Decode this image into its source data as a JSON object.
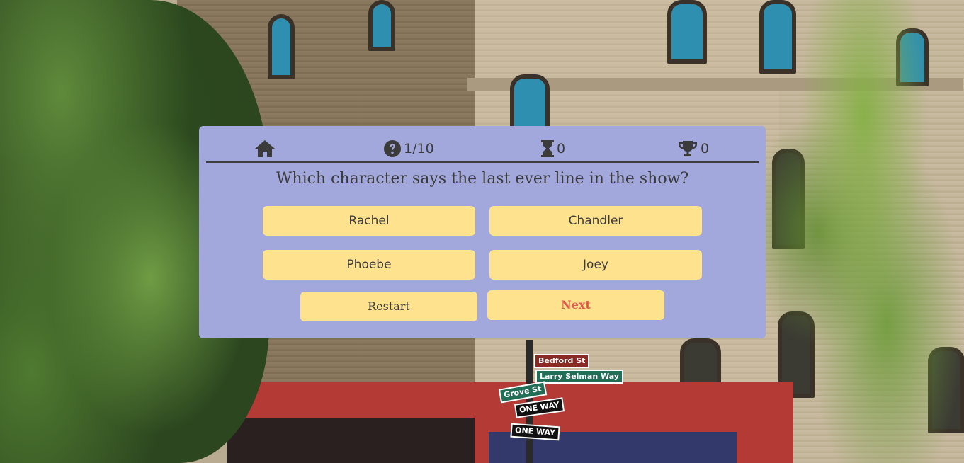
{
  "stats": {
    "question_progress": "1/10",
    "timer": "0",
    "score": "0"
  },
  "question": {
    "text": "Which character says the last ever line in the show?"
  },
  "answers": [
    {
      "label": "Rachel"
    },
    {
      "label": "Chandler"
    },
    {
      "label": "Phoebe"
    },
    {
      "label": "Joey"
    }
  ],
  "controls": {
    "restart_label": "Restart",
    "next_label": "Next"
  },
  "street_signs": {
    "sign_1": "Bedford St",
    "sign_2": "Larry Selman Way",
    "sign_3": "Grove St",
    "sign_4": "ONE WAY",
    "sign_5": "ONE WAY"
  },
  "colors": {
    "panel": "#a2a7dc",
    "button": "#ffe28e",
    "text": "#3b3b3b",
    "next_text": "#e05a4e"
  },
  "icons": {
    "home": "home-icon",
    "question": "question-circle-icon",
    "timer": "hourglass-icon",
    "score": "trophy-icon"
  }
}
